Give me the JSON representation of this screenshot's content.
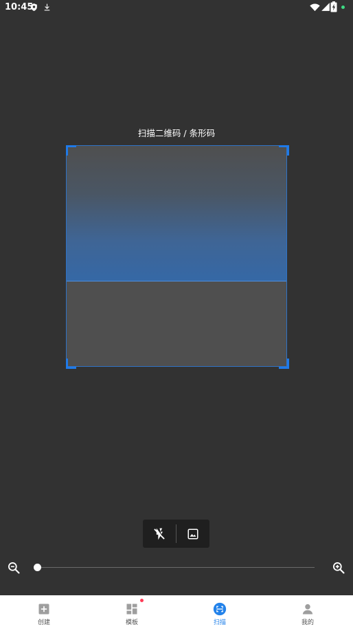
{
  "status_bar": {
    "time": "10:45",
    "icons": [
      "shield-icon",
      "download-icon",
      "wifi-icon",
      "signal-icon",
      "battery-icon",
      "active-dot"
    ]
  },
  "scanner": {
    "title": "扫描二维码 / 条形码",
    "accent_color": "#1f7ae8"
  },
  "tools": {
    "flash": {
      "icon": "flash-off-icon"
    },
    "gallery": {
      "icon": "image-icon"
    }
  },
  "zoom": {
    "out_icon": "zoom-out-icon",
    "in_icon": "zoom-in-icon",
    "level": 0
  },
  "bottom_nav": {
    "items": [
      {
        "label": "创建",
        "icon": "add-box-icon",
        "active": false
      },
      {
        "label": "模板",
        "icon": "dashboard-icon",
        "active": false,
        "badge": true
      },
      {
        "label": "扫描",
        "icon": "scan-icon",
        "active": true
      },
      {
        "label": "我的",
        "icon": "person-icon",
        "active": false
      }
    ],
    "active_color": "#2382ea"
  }
}
